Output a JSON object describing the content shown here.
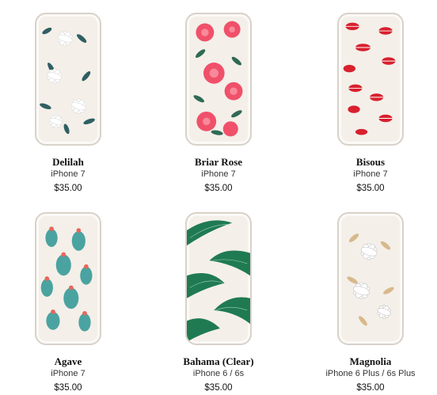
{
  "products": [
    {
      "name": "Delilah",
      "model": "iPhone 7",
      "price": "$35.00",
      "pattern": "white-floral-teal-leaves"
    },
    {
      "name": "Briar Rose",
      "model": "iPhone 7",
      "price": "$35.00",
      "pattern": "pink-roses"
    },
    {
      "name": "Bisous",
      "model": "iPhone 7",
      "price": "$35.00",
      "pattern": "red-lips"
    },
    {
      "name": "Agave",
      "model": "iPhone 7",
      "price": "$35.00",
      "pattern": "cactus"
    },
    {
      "name": "Bahama (Clear)",
      "model": "iPhone 6 / 6s",
      "price": "$35.00",
      "pattern": "palm-leaves"
    },
    {
      "name": "Magnolia",
      "model": "iPhone 6 Plus / 6s Plus",
      "price": "$35.00",
      "pattern": "white-magnolia-gold-leaves"
    }
  ],
  "colors": {
    "teal": "#2f5f63",
    "rose": "#f0506a",
    "lips": "#d8202e",
    "cactus": "#4aa3a0",
    "palm": "#1f7a52",
    "gold": "#d8b98c"
  }
}
